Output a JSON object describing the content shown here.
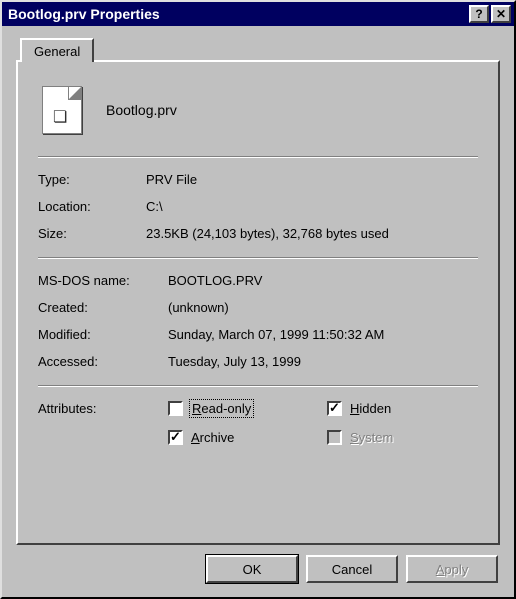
{
  "window": {
    "title": "Bootlog.prv Properties",
    "help_button": "?",
    "close_button": "✕"
  },
  "tab": {
    "general": "General"
  },
  "file": {
    "name": "Bootlog.prv",
    "type_label": "Type:",
    "type_value": "PRV File",
    "location_label": "Location:",
    "location_value": "C:\\",
    "size_label": "Size:",
    "size_value": "23.5KB (24,103 bytes), 32,768 bytes used",
    "dosname_label": "MS-DOS name:",
    "dosname_value": "BOOTLOG.PRV",
    "created_label": "Created:",
    "created_value": "(unknown)",
    "modified_label": "Modified:",
    "modified_value": "Sunday, March 07, 1999 11:50:32 AM",
    "accessed_label": "Accessed:",
    "accessed_value": "Tuesday, July 13, 1999"
  },
  "attributes": {
    "label": "Attributes:",
    "readonly": {
      "label": "Read-only",
      "checked": false,
      "enabled": true,
      "focused": true
    },
    "hidden": {
      "label": "Hidden",
      "checked": true,
      "enabled": true
    },
    "archive": {
      "label": "Archive",
      "checked": true,
      "enabled": true
    },
    "system": {
      "label": "System",
      "checked": false,
      "enabled": false
    }
  },
  "buttons": {
    "ok": "OK",
    "cancel": "Cancel",
    "apply": "Apply"
  }
}
